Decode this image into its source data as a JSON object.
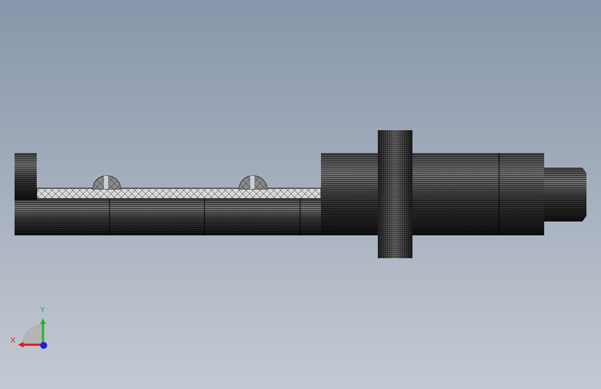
{
  "viewport": {
    "background_top": "#8796aa",
    "background_bottom": "#c4cad3",
    "part_color": "#111111",
    "view_orientation": "front"
  },
  "triad": {
    "x_label": "X",
    "y_label": "Y",
    "x_color": "#e0161c",
    "y_color": "#19b629",
    "z_color": "#1c22d8"
  }
}
